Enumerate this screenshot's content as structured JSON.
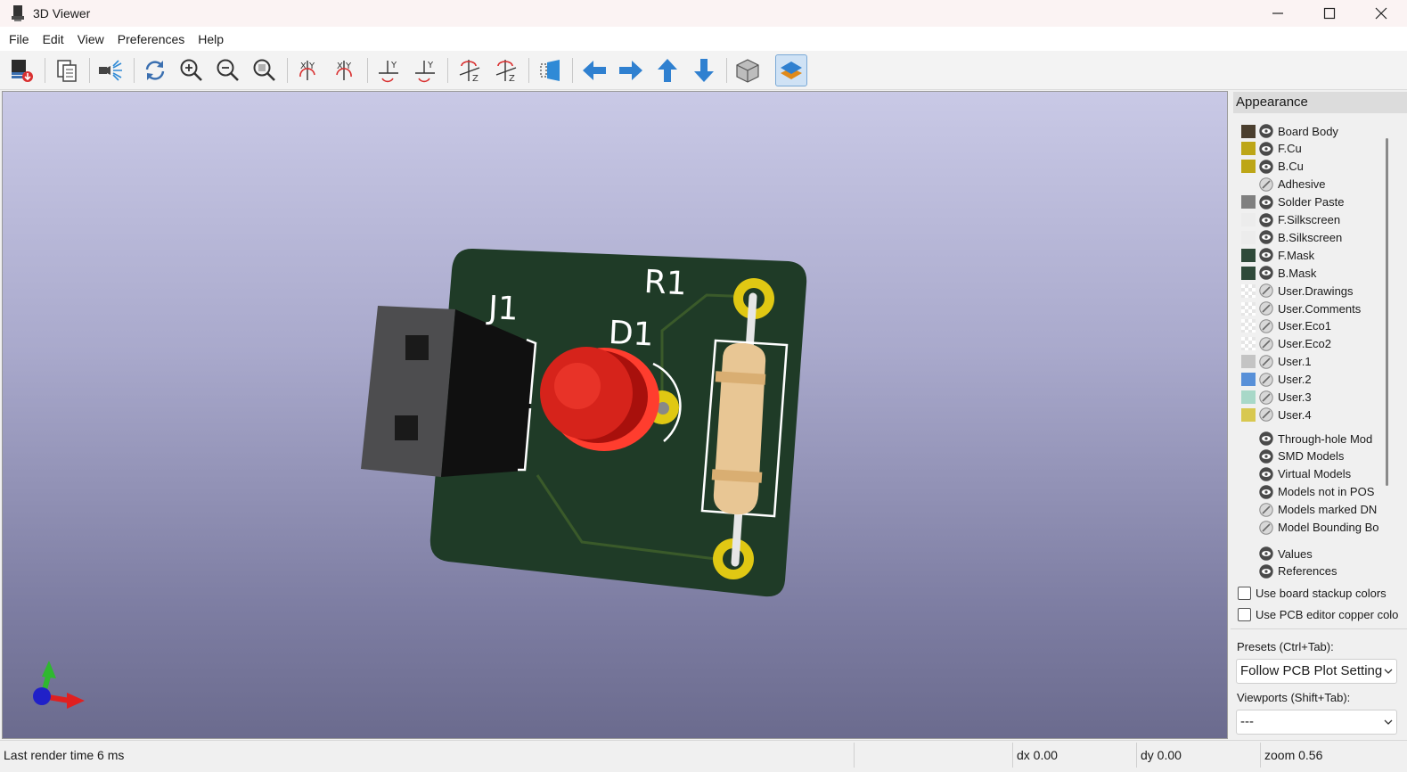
{
  "window": {
    "title": "3D Viewer"
  },
  "menu": [
    "File",
    "Edit",
    "View",
    "Preferences",
    "Help"
  ],
  "toolbar": {
    "buttons": [
      "export-image-icon",
      "copy-to-clipboard-icon",
      "raytracing-icon",
      "reload-icon",
      "zoom-in-icon",
      "zoom-out-icon",
      "zoom-to-fit-icon",
      "rotate-x-cw-icon",
      "rotate-x-ccw-icon",
      "rotate-y-cw-icon",
      "rotate-y-ccw-icon",
      "rotate-z-cw-icon",
      "rotate-z-ccw-icon",
      "flip-board-icon",
      "pan-left-icon",
      "pan-right-icon",
      "pan-up-icon",
      "pan-down-icon",
      "orthographic-icon",
      "layers-manager-icon"
    ],
    "active": "layers-manager-icon"
  },
  "viewport": {
    "labels": {
      "j1": "J1",
      "d1": "D1",
      "r1": "R1"
    }
  },
  "appearance": {
    "header": "Appearance",
    "layers": [
      {
        "name": "Board Body",
        "color": "#4b3f2f",
        "visible": true
      },
      {
        "name": "F.Cu",
        "color": "#bda617",
        "visible": true
      },
      {
        "name": "B.Cu",
        "color": "#bda617",
        "visible": true
      },
      {
        "name": "Adhesive",
        "color": "",
        "visible": false
      },
      {
        "name": "Solder Paste",
        "color": "#808080",
        "visible": true
      },
      {
        "name": "F.Silkscreen",
        "color": "#ececec",
        "visible": true
      },
      {
        "name": "B.Silkscreen",
        "color": "#ececec",
        "visible": true
      },
      {
        "name": "F.Mask",
        "color": "#2f4a3a",
        "visible": true
      },
      {
        "name": "B.Mask",
        "color": "#2f4a3a",
        "visible": true
      },
      {
        "name": "User.Drawings",
        "color": "checker",
        "visible": false
      },
      {
        "name": "User.Comments",
        "color": "checker",
        "visible": false
      },
      {
        "name": "User.Eco1",
        "color": "checker",
        "visible": false
      },
      {
        "name": "User.Eco2",
        "color": "checker",
        "visible": false
      },
      {
        "name": "User.1",
        "color": "#c4c4c4",
        "visible": false
      },
      {
        "name": "User.2",
        "color": "#5890d8",
        "visible": false
      },
      {
        "name": "User.3",
        "color": "#a8d8c8",
        "visible": false
      },
      {
        "name": "User.4",
        "color": "#d8c850",
        "visible": false
      }
    ],
    "models": [
      {
        "name": "Through-hole Mod",
        "visible": true
      },
      {
        "name": "SMD Models",
        "visible": true
      },
      {
        "name": "Virtual Models",
        "visible": true
      },
      {
        "name": "Models not in POS",
        "visible": true
      },
      {
        "name": "Models marked DN",
        "visible": false
      },
      {
        "name": "Model Bounding Bo",
        "visible": false
      }
    ],
    "text": [
      {
        "name": "Values",
        "visible": true
      },
      {
        "name": "References",
        "visible": true
      }
    ],
    "checkboxes": {
      "stackup": "Use board stackup colors",
      "copper": "Use PCB editor copper colo"
    },
    "presets_label": "Presets (Ctrl+Tab):",
    "presets_value": "Follow PCB Plot Setting",
    "viewports_label": "Viewports (Shift+Tab):",
    "viewports_value": "---"
  },
  "status": {
    "render_time": "Last render time 6 ms",
    "dx": "dx 0.00",
    "dy": "dy 0.00",
    "zoom": "zoom 0.56"
  }
}
